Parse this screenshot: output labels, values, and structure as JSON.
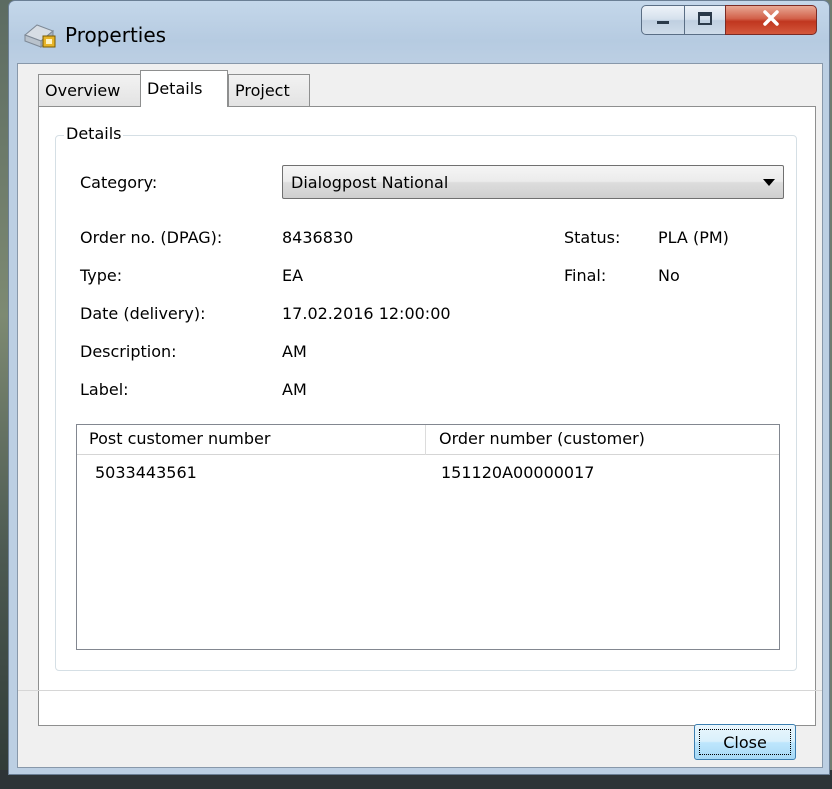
{
  "window": {
    "title": "Properties"
  },
  "tabs": [
    {
      "label": "Overview"
    },
    {
      "label": "Details"
    },
    {
      "label": "Project"
    }
  ],
  "details": {
    "group_title": "Details",
    "category_label": "Category:",
    "category_value": "Dialogpost National",
    "order_no_label": "Order no. (DPAG):",
    "order_no_value": "8436830",
    "type_label": "Type:",
    "type_value": "EA",
    "date_label": "Date (delivery):",
    "date_value": "17.02.2016 12:00:00",
    "description_label": "Description:",
    "description_value": "AM",
    "label_label": "Label:",
    "label_value": "AM",
    "status_label": "Status:",
    "status_value": "PLA (PM)",
    "final_label": "Final:",
    "final_value": "No"
  },
  "list": {
    "columns": [
      "Post customer number",
      "Order number (customer)"
    ],
    "rows": [
      [
        "5033443561",
        "151120A00000017"
      ]
    ]
  },
  "footer": {
    "close_label": "Close"
  },
  "colors": {
    "accent": "#3c7fb1",
    "close_red": "#c0361f",
    "title_bar": "#bccfe3"
  }
}
